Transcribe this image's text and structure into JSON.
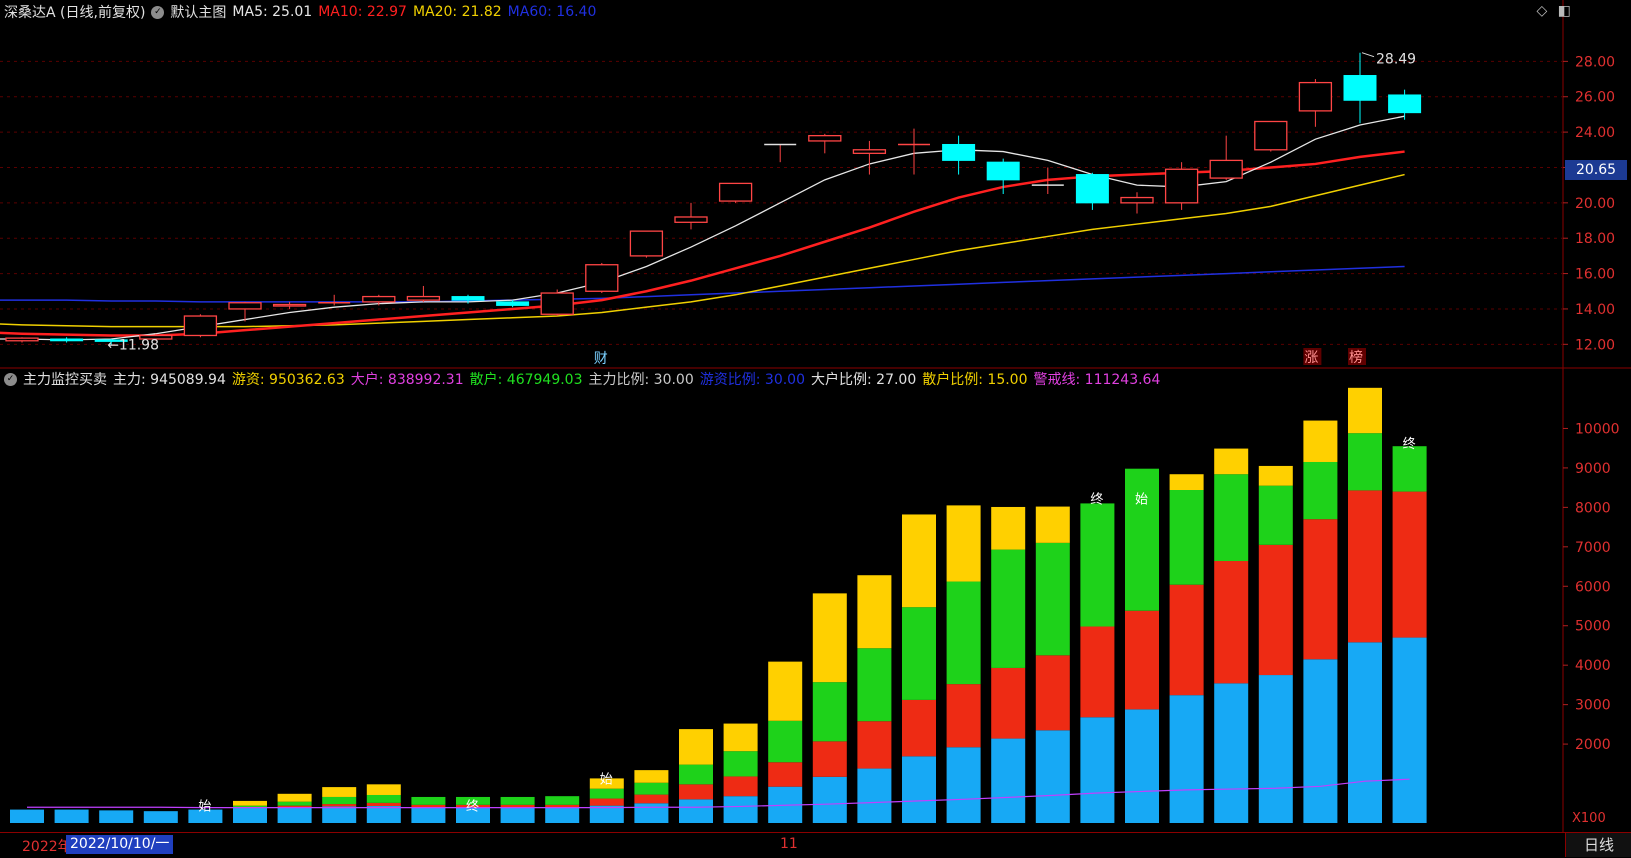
{
  "header": {
    "stock_title": "深桑达A (日线,前复权)",
    "template_label": "默认主图",
    "ma5": "MA5: 25.01",
    "ma10": "MA10: 22.97",
    "ma20": "MA20: 21.82",
    "ma60": "MA60: 16.40",
    "colors": {
      "ma5": "#e6e6e6",
      "ma10": "#ff2020",
      "ma20": "#f0d000",
      "ma60": "#2030e0"
    }
  },
  "top_icons": [
    "diamond-icon",
    "window-toggle-icon"
  ],
  "price_axis": {
    "ticks": [
      "28.00",
      "26.00",
      "24.00",
      "22.00",
      "20.00",
      "18.00",
      "16.00",
      "14.00",
      "12.00"
    ],
    "current_price": "20.65",
    "high_label": "28.49",
    "low_label": "11.98"
  },
  "event_marks": {
    "cai": "财",
    "zhang": "涨",
    "bang": "榜"
  },
  "price_chart_data": {
    "type": "candlestick",
    "ylim": [
      11,
      30
    ],
    "candles": [
      {
        "o": 12.2,
        "c": 12.35,
        "h": 12.4,
        "l": 12.1
      },
      {
        "o": 12.3,
        "c": 12.2,
        "h": 12.4,
        "l": 12.1
      },
      {
        "o": 12.25,
        "c": 12.2,
        "h": 12.3,
        "l": 11.98
      },
      {
        "o": 12.3,
        "c": 12.5,
        "h": 12.6,
        "l": 12.2
      },
      {
        "o": 12.5,
        "c": 13.6,
        "h": 13.7,
        "l": 12.4
      },
      {
        "o": 14.0,
        "c": 14.35,
        "h": 14.4,
        "l": 13.3
      },
      {
        "o": 14.2,
        "c": 14.25,
        "h": 14.4,
        "l": 14.0
      },
      {
        "o": 14.35,
        "c": 14.35,
        "h": 14.8,
        "l": 14.2
      },
      {
        "o": 14.4,
        "c": 14.7,
        "h": 14.8,
        "l": 14.2
      },
      {
        "o": 14.5,
        "c": 14.7,
        "h": 15.3,
        "l": 14.4
      },
      {
        "o": 14.7,
        "c": 14.5,
        "h": 14.8,
        "l": 14.3
      },
      {
        "o": 14.4,
        "c": 14.2,
        "h": 14.5,
        "l": 14.1
      },
      {
        "o": 13.7,
        "c": 14.9,
        "h": 15.1,
        "l": 13.6
      },
      {
        "o": 15.0,
        "c": 16.5,
        "h": 16.6,
        "l": 14.9
      },
      {
        "o": 17.0,
        "c": 18.4,
        "h": 18.4,
        "l": 16.9
      },
      {
        "o": 18.9,
        "c": 19.2,
        "h": 20.0,
        "l": 18.5
      },
      {
        "o": 20.1,
        "c": 21.1,
        "h": 21.1,
        "l": 20.0
      },
      {
        "o": 23.3,
        "c": 23.3,
        "h": 23.3,
        "l": 22.3
      },
      {
        "o": 23.5,
        "c": 23.8,
        "h": 23.9,
        "l": 22.8
      },
      {
        "o": 22.8,
        "c": 23.0,
        "h": 23.5,
        "l": 21.6
      },
      {
        "o": 23.3,
        "c": 23.3,
        "h": 24.2,
        "l": 21.6
      },
      {
        "o": 23.3,
        "c": 22.4,
        "h": 23.8,
        "l": 21.6
      },
      {
        "o": 22.3,
        "c": 21.3,
        "h": 22.5,
        "l": 20.5
      },
      {
        "o": 21.0,
        "c": 21.0,
        "h": 22.0,
        "l": 20.5
      },
      {
        "o": 21.6,
        "c": 20.0,
        "h": 21.7,
        "l": 19.6
      },
      {
        "o": 20.0,
        "c": 20.3,
        "h": 20.6,
        "l": 19.4
      },
      {
        "o": 20.0,
        "c": 21.9,
        "h": 22.3,
        "l": 19.6
      },
      {
        "o": 21.4,
        "c": 22.4,
        "h": 23.8,
        "l": 21.3
      },
      {
        "o": 23.0,
        "c": 24.6,
        "h": 24.6,
        "l": 22.9
      },
      {
        "o": 25.2,
        "c": 26.8,
        "h": 27.0,
        "l": 24.3
      },
      {
        "o": 27.2,
        "c": 25.8,
        "h": 28.49,
        "l": 24.5
      },
      {
        "o": 26.1,
        "c": 25.1,
        "h": 26.4,
        "l": 24.7
      }
    ],
    "ma5": [
      12.3,
      12.3,
      12.25,
      12.3,
      12.6,
      13.0,
      13.4,
      13.8,
      14.1,
      14.3,
      14.4,
      14.4,
      14.5,
      14.9,
      15.5,
      16.4,
      17.5,
      18.7,
      20.0,
      21.3,
      22.2,
      22.8,
      23.0,
      22.9,
      22.4,
      21.6,
      21.0,
      20.9,
      21.2,
      22.3,
      23.6,
      24.4,
      24.9
    ],
    "ma10": [
      12.7,
      12.6,
      12.55,
      12.5,
      12.5,
      12.6,
      12.8,
      13.0,
      13.2,
      13.4,
      13.6,
      13.8,
      14.0,
      14.2,
      14.5,
      15.0,
      15.6,
      16.3,
      17.0,
      17.8,
      18.6,
      19.5,
      20.3,
      20.9,
      21.3,
      21.5,
      21.6,
      21.7,
      21.8,
      22.0,
      22.2,
      22.6,
      22.9
    ],
    "ma20": [
      13.2,
      13.1,
      13.05,
      13.0,
      13.0,
      13.0,
      13.0,
      13.05,
      13.1,
      13.2,
      13.3,
      13.4,
      13.5,
      13.6,
      13.8,
      14.1,
      14.4,
      14.8,
      15.3,
      15.8,
      16.3,
      16.8,
      17.3,
      17.7,
      18.1,
      18.5,
      18.8,
      19.1,
      19.4,
      19.8,
      20.4,
      21.0,
      21.6
    ],
    "ma60": [
      14.5,
      14.5,
      14.5,
      14.45,
      14.45,
      14.4,
      14.4,
      14.4,
      14.4,
      14.4,
      14.4,
      14.45,
      14.5,
      14.55,
      14.6,
      14.7,
      14.8,
      14.9,
      15.0,
      15.1,
      15.2,
      15.3,
      15.4,
      15.5,
      15.6,
      15.7,
      15.8,
      15.9,
      16.0,
      16.1,
      16.2,
      16.3,
      16.4
    ]
  },
  "indicator": {
    "name": "主力监控买卖",
    "zhuli": "主力: 945089.94",
    "youzi": "游资: 950362.63",
    "dahu": "大户: 838992.31",
    "sanhu": "散户: 467949.03",
    "zhuli_ratio": "主力比例: 30.00",
    "youzi_ratio": "游资比例: 30.00",
    "dahu_ratio": "大户比例: 27.00",
    "sanhu_ratio": "散户比例: 15.00",
    "warning": "警戒线: 111243.64",
    "colors": {
      "blue": "#17a9f5",
      "red": "#ee2b14",
      "green": "#1ed21a",
      "yellow": "#ffd000",
      "warning": "#c040ff"
    },
    "axis_ticks": [
      "10000",
      "9000",
      "8000",
      "7000",
      "6000",
      "5000",
      "4000",
      "3000",
      "2000"
    ],
    "unit_label": "X100",
    "marks": {
      "shi": "始",
      "zhong": "终"
    }
  },
  "chart_data": {
    "type": "bar",
    "stacked": true,
    "ylim": [
      0,
      11000
    ],
    "categories_count": 32,
    "series": [
      {
        "key": "blue",
        "values": [
          340,
          340,
          320,
          300,
          340,
          380,
          400,
          420,
          430,
          400,
          400,
          400,
          380,
          440,
          500,
          600,
          680,
          920,
          1170,
          1380,
          1690,
          1920,
          2140,
          2350,
          2680,
          2880,
          3240,
          3540,
          3750,
          4150,
          4580,
          4700
        ]
      },
      {
        "key": "red",
        "values": [
          0,
          0,
          0,
          0,
          0,
          0,
          40,
          60,
          80,
          60,
          60,
          60,
          80,
          180,
          220,
          380,
          500,
          620,
          900,
          1200,
          1430,
          1600,
          1790,
          1900,
          2300,
          2500,
          2800,
          3100,
          3300,
          3550,
          3850,
          3700
        ]
      },
      {
        "key": "green",
        "values": [
          0,
          0,
          0,
          0,
          0,
          60,
          100,
          180,
          200,
          200,
          200,
          200,
          220,
          250,
          300,
          500,
          640,
          1050,
          1500,
          1850,
          2350,
          2600,
          3000,
          2850,
          3120,
          3600,
          2400,
          2200,
          1500,
          1450,
          1450,
          1150
        ]
      },
      {
        "key": "yellow",
        "values": [
          0,
          0,
          0,
          0,
          0,
          120,
          200,
          250,
          270,
          0,
          0,
          0,
          0,
          260,
          320,
          900,
          700,
          1500,
          2250,
          1850,
          2350,
          1930,
          1080,
          920,
          0,
          0,
          400,
          650,
          500,
          1050,
          1150,
          0
        ]
      }
    ],
    "warning_line": [
      400,
      400,
      400,
      400,
      390,
      390,
      390,
      390,
      390,
      390,
      390,
      390,
      390,
      390,
      400,
      400,
      420,
      450,
      480,
      520,
      560,
      600,
      650,
      700,
      760,
      800,
      840,
      860,
      880,
      930,
      1060,
      1110
    ]
  },
  "bottom_bar": {
    "date_red": "2022年",
    "date_selected": "2022/10/10/一",
    "month_label": "11",
    "period": "日线"
  }
}
